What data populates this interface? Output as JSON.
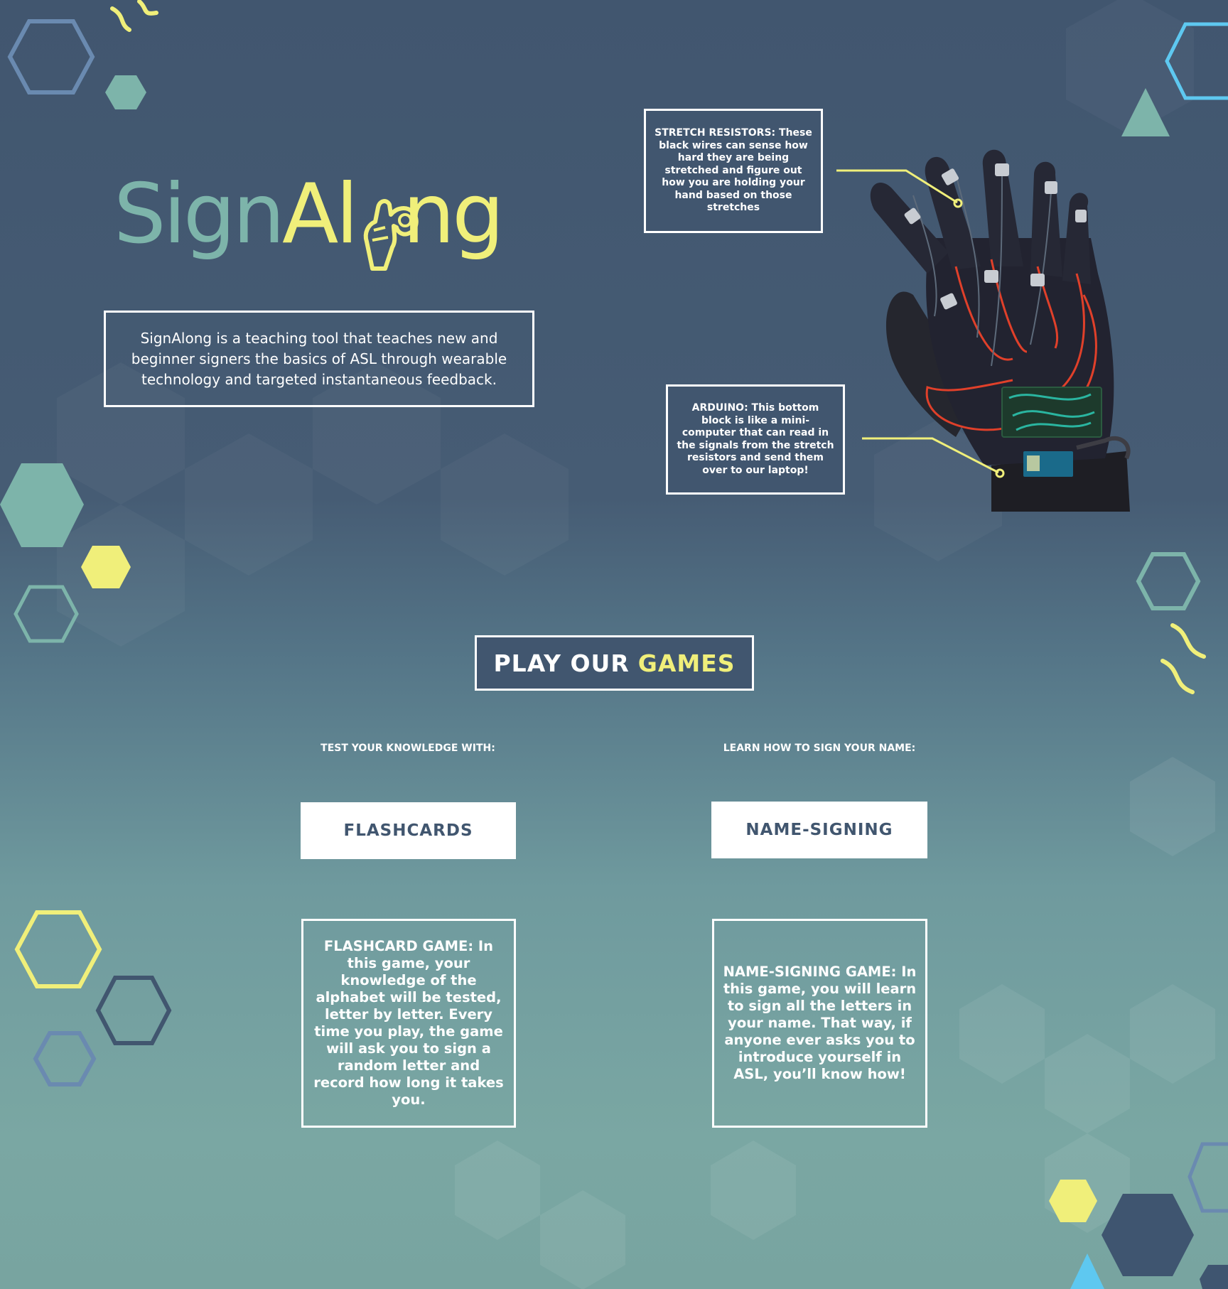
{
  "brand": {
    "logo_part1": "Sign",
    "logo_part2": "Al",
    "logo_part3": "ng",
    "primary_color": "#41566f",
    "accent_yellow": "#f0ef7a",
    "accent_teal": "#7db4aa"
  },
  "intro": {
    "description": "SignAlong is a teaching tool that teaches new and beginner signers the basics of ASL through wearable technology and targeted instantaneous feedback."
  },
  "glove": {
    "stretch_callout": "STRETCH RESISTORS: These black wires can sense how hard they are being stretched and figure out how you are holding your hand based on those stretches",
    "arduino_callout": "ARDUINO: This bottom block is like a mini-computer that can read in the signals from the stretch resistors and send them over to our laptop!"
  },
  "games": {
    "heading_part1": "PLAY OUR",
    "heading_part2": "GAMES",
    "left_label": "TEST YOUR KNOWLEDGE WITH:",
    "right_label": "LEARN HOW TO SIGN YOUR NAME:",
    "flashcards_button": "FLASHCARDS",
    "name_signing_button": "NAME-SIGNING",
    "flashcards_desc": "FLASHCARD GAME: In this game, your knowledge of the alphabet will be tested, letter by letter. Every time you play, the game will ask you to sign a random letter and record how long it takes you.",
    "name_signing_desc": "NAME-SIGNING GAME: In this game, you will learn to sign all the letters in your name. That way, if anyone ever asks you to introduce yourself in ASL, you’ll know how!"
  }
}
